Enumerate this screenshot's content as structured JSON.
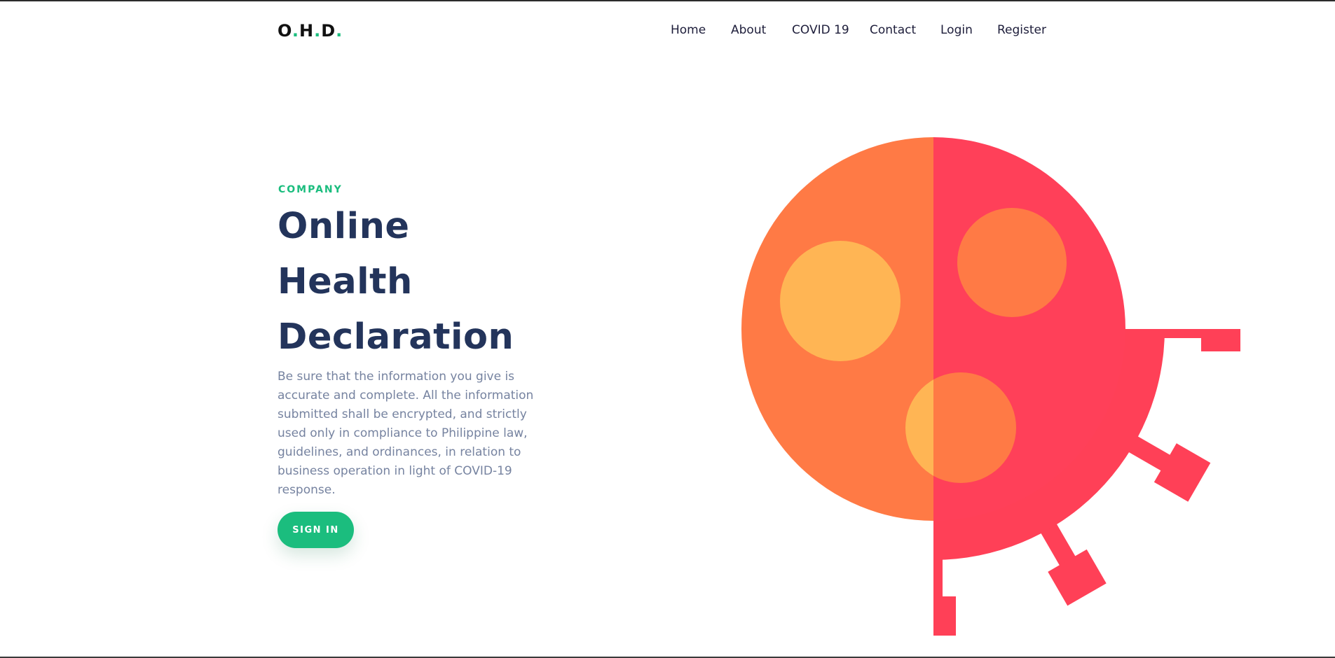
{
  "brand": {
    "logo_parts": [
      "O",
      ".",
      "H",
      ".",
      "D",
      "."
    ],
    "accent_color": "#1bbd7e"
  },
  "nav": {
    "items": [
      "Home",
      "About",
      "COVID 19",
      "Contact",
      "Login",
      "Register"
    ]
  },
  "hero": {
    "eyebrow": "COMPANY",
    "title_lines": [
      "Online",
      "Health",
      "Declaration"
    ],
    "description": "Be sure that the information you give is accurate and complete. All the information submitted shall be encrypted, and strictly used only in compliance to Philippine law, guidelines, and ordinances, in relation to business operation in light of COVID-19 response.",
    "cta_label": "SIGN IN"
  },
  "illustration": {
    "icon": "virus-icon",
    "colors": {
      "left_spike": "#ff4057",
      "right_spike": "#e3005a",
      "left_core": "#ff7a45",
      "right_core": "#ff4059",
      "spot_light": "#ffb554",
      "spot_dark": "#ff7a45"
    }
  },
  "colors": {
    "heading": "#23345b",
    "body_text": "#7683a0",
    "nav_text": "#1d1d3a"
  }
}
